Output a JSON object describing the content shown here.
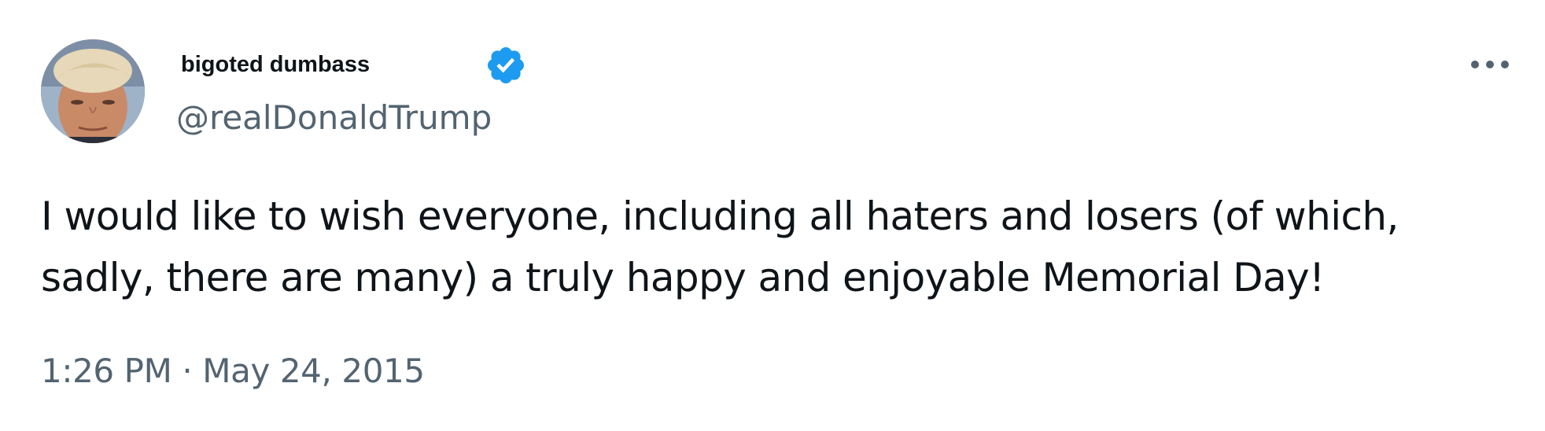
{
  "tweet": {
    "author": {
      "display_name": "bigoted dumbass",
      "handle": "@realDonaldTrump",
      "verified": true,
      "avatar_icon": "profile-photo"
    },
    "more_icon": "ellipsis-horizontal-icon",
    "text": "I would like to wish everyone, including all haters and losers (of which,\nsadly, there are many) a truly happy and enjoyable Memorial Day!",
    "timestamp": "1:26 PM · May 24, 2015"
  },
  "colors": {
    "primary_text": "#0f1419",
    "secondary_text": "#536471",
    "verified_blue": "#1d9bf0",
    "background": "#ffffff"
  }
}
